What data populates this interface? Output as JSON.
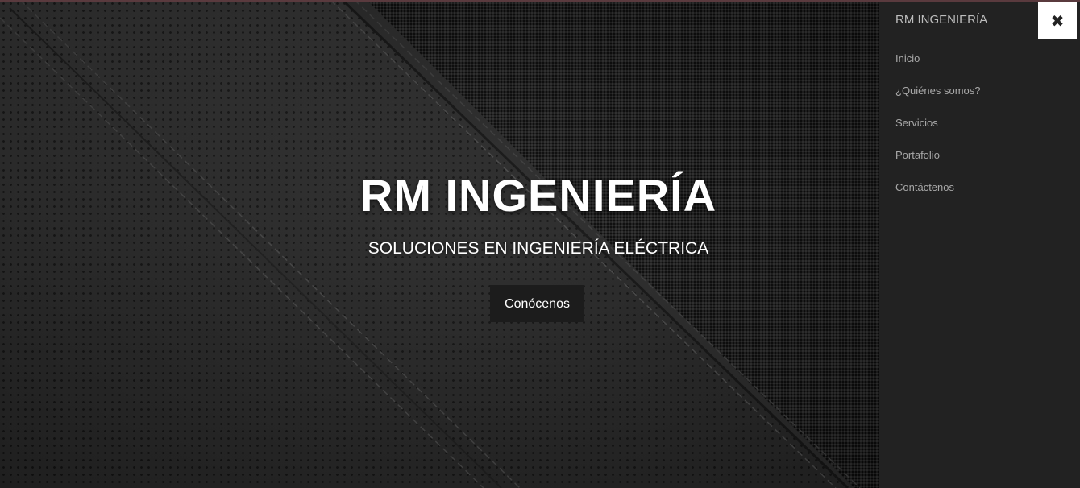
{
  "header": {
    "brand": "RM INGENIERÍA",
    "close_icon": "close-icon",
    "close_glyph": "✖"
  },
  "nav": {
    "items": [
      {
        "label": "Inicio"
      },
      {
        "label": "¿Quiénes somos?"
      },
      {
        "label": "Servicios"
      },
      {
        "label": "Portafolio"
      },
      {
        "label": "Contáctenos"
      }
    ]
  },
  "hero": {
    "title": "RM INGENIERÍA",
    "subtitle": "SOLUCIONES EN INGENIERÍA ELÉCTRICA",
    "button_label": "Conócenos"
  },
  "colors": {
    "side_menu_bg": "#222222",
    "menu_text": "#a8a8a8",
    "hero_text": "#ffffff",
    "button_bg": "#1c1c1c"
  }
}
